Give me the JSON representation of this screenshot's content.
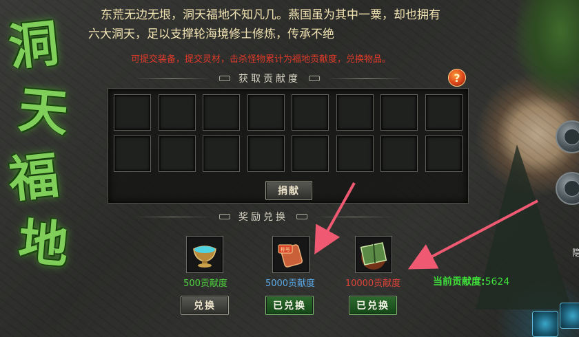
{
  "title_banner": {
    "text": "洞天福地",
    "chars": [
      "洞",
      "天",
      "福",
      "地"
    ]
  },
  "intro": {
    "line1": "东荒无边无垠，洞天福地不知凡几。燕国虽为其中一粟，却也拥有",
    "line2": "六大洞天，足以支撑轮海境修士修炼，传承不绝"
  },
  "note": "可提交装备，提交灵材，击杀怪物累计为福地贡献度，兑换物品。",
  "help_icon": {
    "glyph": "?",
    "icon": "question-icon"
  },
  "submit_section": {
    "title": "获取贡献度",
    "slots_count": 16,
    "donate_label": "捐献"
  },
  "exchange_section": {
    "title": "奖励兑换",
    "rewards": [
      {
        "icon": "jade-bowl-icon",
        "cost_text": "500贡献度",
        "cost_color": "#4fd43f",
        "button_label": "兑换",
        "button_state": "available"
      },
      {
        "icon": "scroll-title-icon",
        "cost_text": "5000贡献度",
        "cost_color": "#5aa9e8",
        "button_label": "已兑换",
        "button_state": "redeemed"
      },
      {
        "icon": "skill-book-icon",
        "cost_text": "10000贡献度",
        "cost_color": "#e04438",
        "button_label": "已兑换",
        "button_state": "redeemed"
      }
    ]
  },
  "current": {
    "label": "当前贡献度:",
    "value": "5624"
  },
  "side_label": "隐",
  "colors": {
    "accent_green": "#3ee039",
    "note_red": "#e23a2a",
    "intro_text": "#f2e3b2",
    "arrow": "#ef5a72"
  }
}
